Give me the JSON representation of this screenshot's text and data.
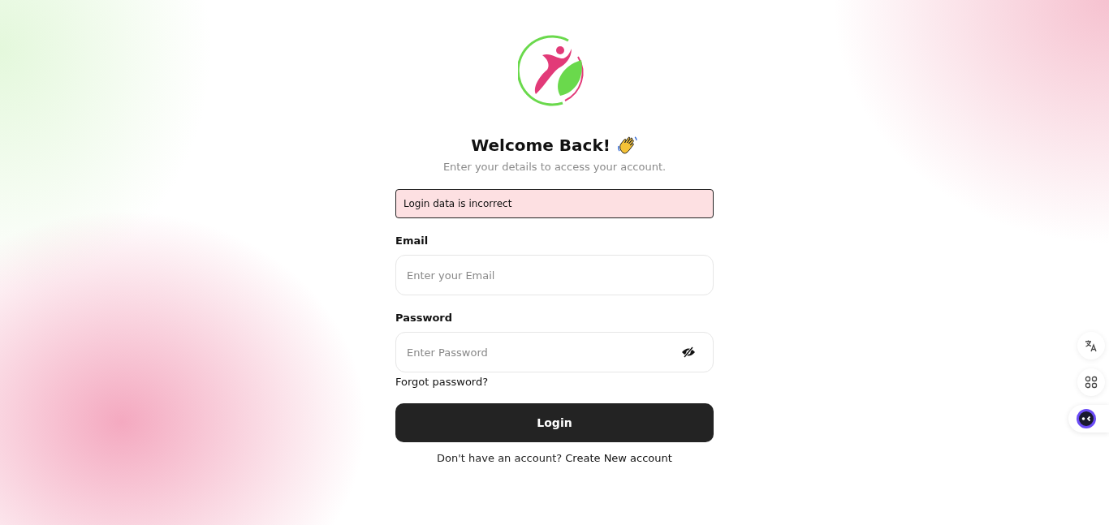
{
  "title": "Welcome Back!",
  "subtitle": "Enter your details to access your account.",
  "alert": {
    "text": "Login data is incorrect"
  },
  "fields": [
    {
      "kind": "email",
      "label": "Email",
      "placeholder": "Enter your Email"
    },
    {
      "kind": "password",
      "label": "Password",
      "placeholder": "Enter Password"
    }
  ],
  "forgot_link": "Forgot password?",
  "login_button": "Login",
  "signup": {
    "prompt": "Don't have an account?",
    "link": "Create New account"
  }
}
